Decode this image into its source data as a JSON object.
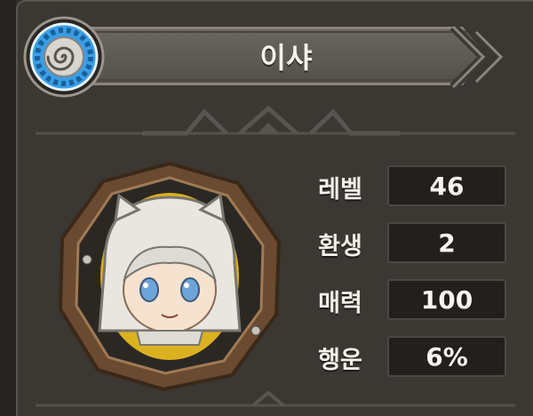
{
  "character": {
    "name": "이샤"
  },
  "stats": [
    {
      "label": "레벨",
      "value": "46"
    },
    {
      "label": "환생",
      "value": "2"
    },
    {
      "label": "매력",
      "value": "100"
    },
    {
      "label": "행운",
      "value": "6%"
    }
  ],
  "icons": {
    "emblem": "spiral-emblem-icon",
    "portrait": "character-portrait"
  },
  "colors": {
    "panel": "#3b3733",
    "banner": "#605b56",
    "emblem_blue": "#3aa0e8",
    "frame_brown": "#7a5a3c",
    "portrait_glow": "#f0c020"
  }
}
